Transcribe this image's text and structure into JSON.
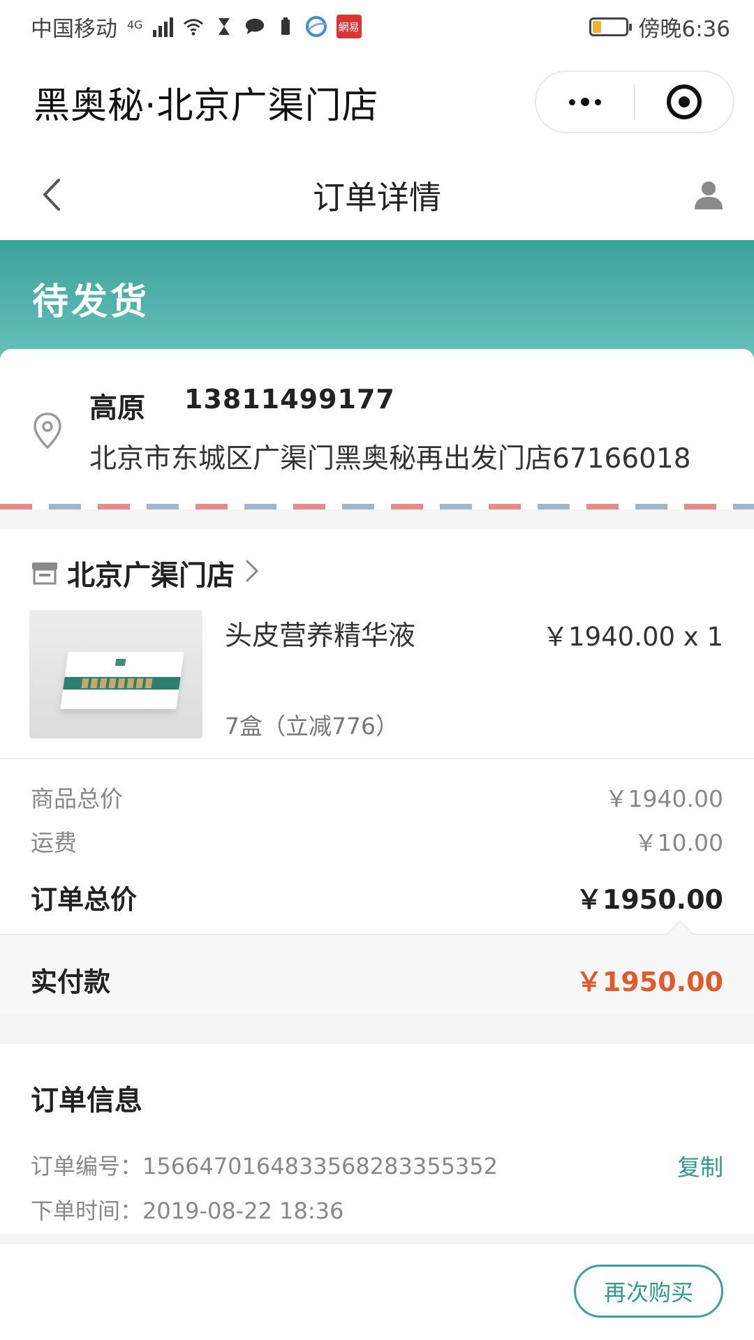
{
  "status_bar": {
    "carrier": "中国移动",
    "network": "4G",
    "app_badge": "網易",
    "time": "傍晚6:36"
  },
  "title_bar": {
    "store_title": "黑奥秘·北京广渠门店"
  },
  "nav": {
    "title": "订单详情"
  },
  "order_status": {
    "text": "待发货",
    "accent_color": "#3aa29a"
  },
  "address": {
    "name": "高原",
    "phone": "13811499177",
    "line": "北京市东城区广渠门黑奥秘再出发门店67166018"
  },
  "shop": {
    "name": "北京广渠门店"
  },
  "product": {
    "name": "头皮营养精华液",
    "price_qty": "￥1940.00 x 1",
    "spec": "7盒（立减776）"
  },
  "summary": {
    "goods_label": "商品总价",
    "goods_value": "￥1940.00",
    "shipping_label": "运费",
    "shipping_value": "￥10.00",
    "total_label": "订单总价",
    "total_value": "￥1950.00",
    "paid_label": "实付款",
    "paid_value": "￥1950.00",
    "paid_color": "#e05a2b"
  },
  "order_info": {
    "title": "订单信息",
    "number_label": "订单编号：",
    "number_value": "1566470164833568283355352",
    "copy_label": "复制",
    "time_label": "下单时间：",
    "time_value": "2019-08-22 18:36"
  },
  "actions": {
    "rebuy_label": "再次购买"
  },
  "icons": {
    "back": "chevron-left-icon",
    "user": "user-icon",
    "location": "location-pin-icon",
    "shop": "shop-icon",
    "more": "more-dots-icon",
    "close": "target-close-icon"
  }
}
